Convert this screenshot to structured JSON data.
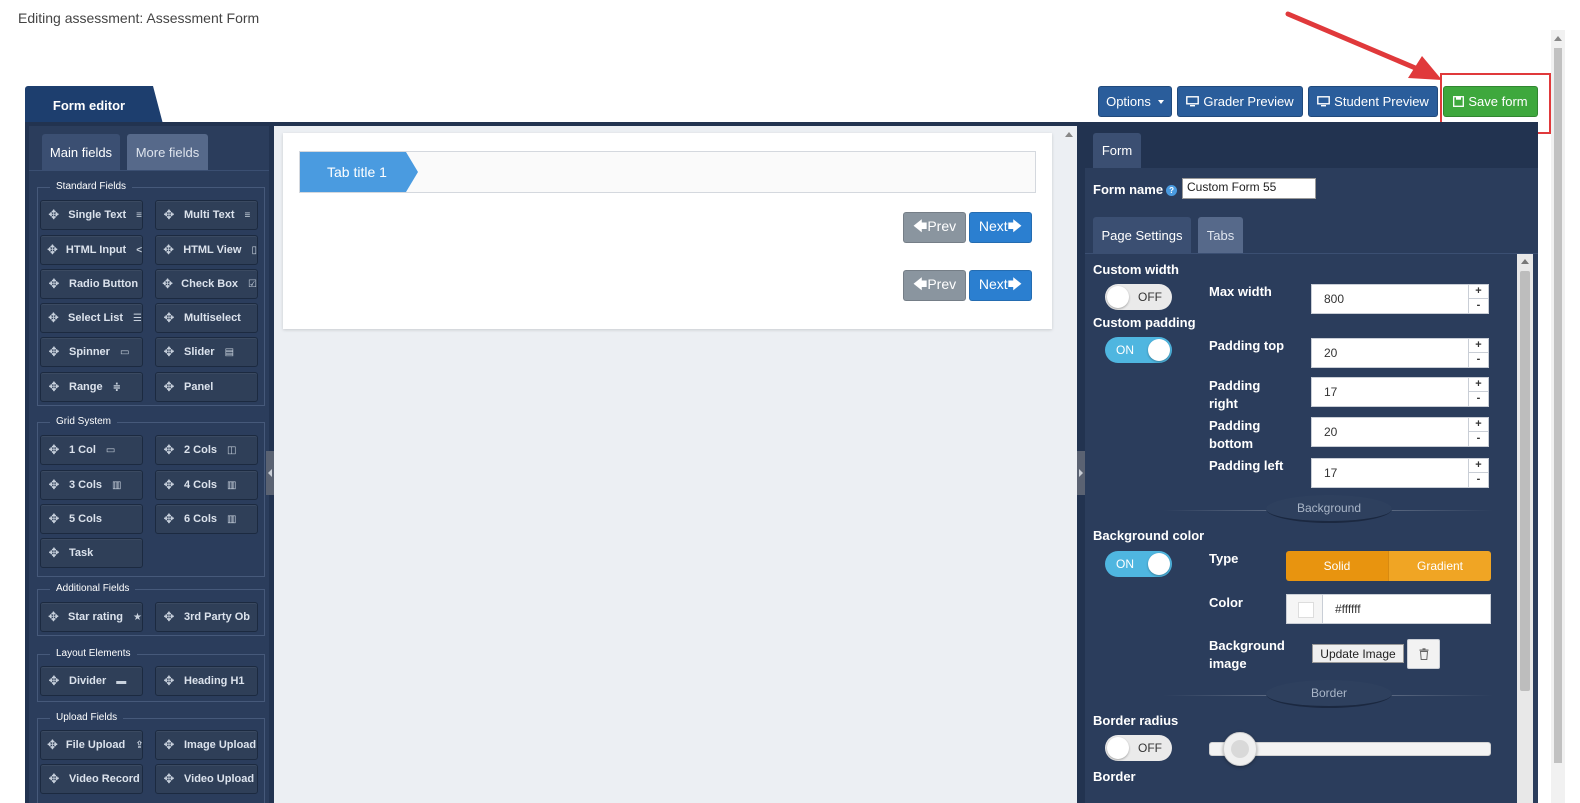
{
  "page": {
    "heading": "Editing assessment: Assessment Form"
  },
  "top_tab": {
    "label": "Form editor"
  },
  "toolbar": {
    "options_label": "Options",
    "grader_preview_label": "Grader Preview",
    "student_preview_label": "Student Preview",
    "save_label": "Save form"
  },
  "left_panel": {
    "tabs": [
      {
        "label": "Main fields"
      },
      {
        "label": "More fields"
      }
    ],
    "groups": [
      {
        "title": "Standard Fields",
        "items": [
          {
            "label": "Single Text",
            "icon": "≡"
          },
          {
            "label": "Multi Text",
            "icon": "≡"
          },
          {
            "label": "HTML Input",
            "icon": "</>"
          },
          {
            "label": "HTML View",
            "icon": "▯"
          },
          {
            "label": "Radio Button",
            "icon": ""
          },
          {
            "label": "Check Box",
            "icon": "☑"
          },
          {
            "label": "Select List",
            "icon": "☰"
          },
          {
            "label": "Multiselect",
            "icon": ""
          },
          {
            "label": "Spinner",
            "icon": "▭"
          },
          {
            "label": "Slider",
            "icon": "▤"
          },
          {
            "label": "Range",
            "icon": "≑"
          },
          {
            "label": "Panel",
            "icon": ""
          }
        ]
      },
      {
        "title": "Grid System",
        "items": [
          {
            "label": "1 Col",
            "icon": "▭"
          },
          {
            "label": "2 Cols",
            "icon": "◫"
          },
          {
            "label": "3 Cols",
            "icon": "▥"
          },
          {
            "label": "4 Cols",
            "icon": "▥"
          },
          {
            "label": "5 Cols",
            "icon": ""
          },
          {
            "label": "6 Cols",
            "icon": "▥"
          },
          {
            "label": "Task",
            "icon": ""
          }
        ]
      },
      {
        "title": "Additional Fields",
        "items": [
          {
            "label": "Star rating",
            "icon": "★"
          },
          {
            "label": "3rd Party Ob",
            "icon": ""
          }
        ]
      },
      {
        "title": "Layout Elements",
        "items": [
          {
            "label": "Divider",
            "icon": "▬"
          },
          {
            "label": "Heading H1",
            "icon": ""
          }
        ]
      },
      {
        "title": "Upload Fields",
        "items": [
          {
            "label": "File Upload",
            "icon": "⇪"
          },
          {
            "label": "Image Upload",
            "icon": ""
          },
          {
            "label": "Video Record",
            "icon": ""
          },
          {
            "label": "Video Upload",
            "icon": ""
          }
        ]
      }
    ]
  },
  "canvas": {
    "tab_title": "Tab title 1",
    "prev_label": "🡄Prev",
    "next_label": "Next🡆"
  },
  "right_panel": {
    "tab_label": "Form",
    "form_name_label": "Form name",
    "form_name_value": "Custom Form 55",
    "sub_tabs": [
      {
        "label": "Page Settings"
      },
      {
        "label": "Tabs"
      }
    ],
    "custom_width_label": "Custom width",
    "custom_width_state": "OFF",
    "custom_padding_label": "Custom padding",
    "custom_padding_state": "ON",
    "max_width_label": "Max width",
    "max_width_value": "800",
    "padding_top_label": "Padding top",
    "padding_top_value": "20",
    "padding_right_label": "Padding right",
    "padding_right_value": "17",
    "padding_bottom_label": "Padding bottom",
    "padding_bottom_value": "20",
    "padding_left_label": "Padding left",
    "padding_left_value": "17",
    "background_section": "Background",
    "background_color_label": "Background color",
    "background_color_state": "ON",
    "type_label": "Type",
    "type_options": [
      "Solid",
      "Gradient"
    ],
    "color_label": "Color",
    "color_value": "#ffffff",
    "background_image_label": "Background image",
    "update_image_label": "Update Image",
    "border_section": "Border",
    "border_radius_label": "Border radius",
    "border_radius_state": "OFF",
    "border_label": "Border",
    "plus": "+",
    "minus": "-"
  },
  "colors": {
    "navy": "#223350",
    "panel": "#2b3d5c",
    "primary": "#2a5d9b",
    "success": "#3ea83d",
    "accent_orange": "#e8940f",
    "toggle_on": "#4fb6e0",
    "annotation_red": "#e0393b"
  }
}
